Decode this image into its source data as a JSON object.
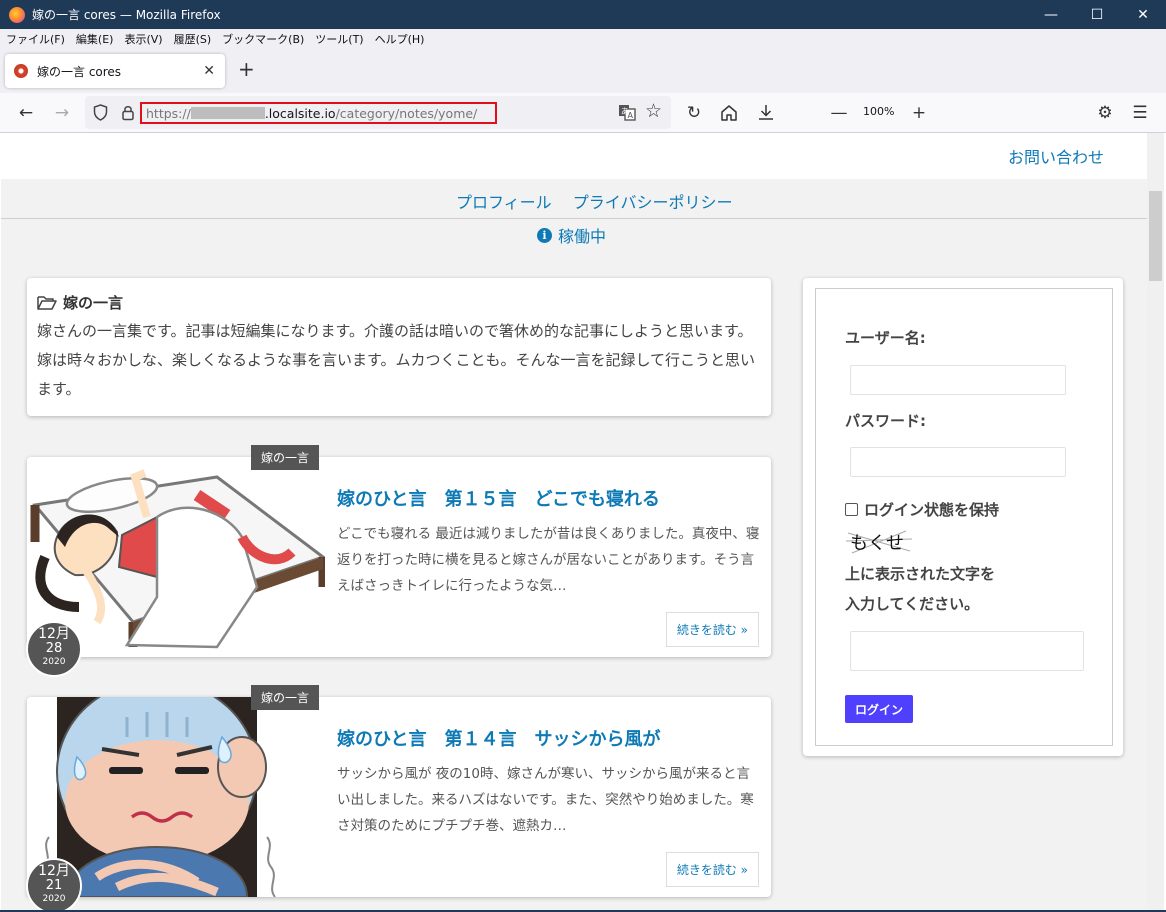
{
  "window": {
    "title": "嫁の一言  cores — Mozilla Firefox",
    "controls": {
      "minimize": "—",
      "maximize": "☐",
      "close": "✕"
    }
  },
  "menu": [
    "ファイル(F)",
    "編集(E)",
    "表示(V)",
    "履歴(S)",
    "ブックマーク(B)",
    "ツール(T)",
    "ヘルプ(H)"
  ],
  "tab": {
    "title": "嫁の一言  cores",
    "close": "✕",
    "new_tab": "+"
  },
  "navbar": {
    "url_prefix": "https://",
    "url_host": ".localsite.io",
    "url_path": "/category/notes/yome/",
    "zoom": "100%"
  },
  "site": {
    "contact": "お問い合わせ",
    "nav": [
      "プロフィール",
      "プライバシーポリシー"
    ],
    "status": "稼働中",
    "category": {
      "name": "嫁の一言",
      "description": "嫁さんの一言集です。記事は短編集になります。介護の話は暗いので箸休め的な記事にしようと思います。嫁は時々おかしな、楽しくなるような事を言います。ムカつくことも。そんな一言を記録して行こうと思います。"
    },
    "posts": [
      {
        "tag": "嫁の一言",
        "title": "嫁のひと言　第１５言　どこでも寝れる",
        "excerpt": "どこでも寝れる 最近は減りましたが昔は良くありました。真夜中、寝返りを打った時に横を見ると嫁さんが居ないことがあります。そう言えばさっきトイレに行ったような気…",
        "read_more": "続きを読む »",
        "date": {
          "month": "12月",
          "day": "28",
          "year": "2020"
        }
      },
      {
        "tag": "嫁の一言",
        "title": "嫁のひと言　第１４言　サッシから風が",
        "excerpt": "サッシから風が 夜の10時、嫁さんが寒い、サッシから風が来ると言い出しました。来るハズはないです。また、突然やり始めました。寒さ対策のためにプチプチ巻、遮熱カ…",
        "read_more": "続きを読む »",
        "date": {
          "month": "12月",
          "day": "21",
          "year": "2020"
        }
      }
    ],
    "login": {
      "username_label": "ユーザー名:",
      "password_label": "パスワード:",
      "remember": "ログイン状態を保持",
      "captcha_text": "もくせ",
      "captcha_prompt_1": "上に表示された文字を",
      "captcha_prompt_2": "入力してください。",
      "button": "ログイン"
    }
  }
}
